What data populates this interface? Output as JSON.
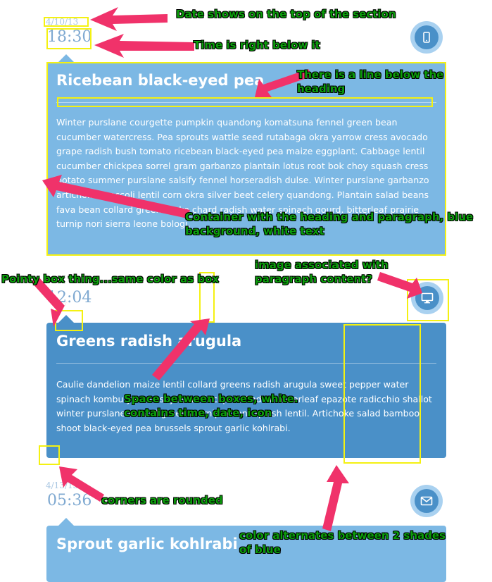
{
  "entries": [
    {
      "date": "4/10/13",
      "time": "18:30",
      "title": "Ricebean black-eyed pea",
      "body": "Winter purslane courgette pumpkin quandong komatsuna fennel green bean cucumber watercress. Pea sprouts wattle seed rutabaga okra yarrow cress avocado grape radish bush tomato ricebean black-eyed pea maize eggplant. Cabbage lentil cucumber chickpea sorrel gram garbanzo plantain lotus root bok choy squash cress potato summer purslane salsify fennel horseradish dulse. Winter purslane garbanzo artichoke broccoli lentil corn okra silver beet celery quandong. Plantain salad beans fava bean collard greens soko chard radish water spinach gourd. bitterleaf prairie turnip nori sierra leone bologi.",
      "icon": "phone-icon"
    },
    {
      "date": "",
      "time": "12:04",
      "title": "Greens radish arugula",
      "body": "Caulie dandelion maize lentil collard greens radish arugula sweet pepper water spinach kombu yarrow soybean chickpea. Endive bitterleaf epazote radicchio shallot winter purslane collard greens turnip onion squash lentil. Artichoke salad bamboo shoot black-eyed pea brussels sprout garlic kohlrabi.",
      "icon": "monitor-icon"
    },
    {
      "date": "4/13/13",
      "time": "05:36",
      "title": "Sprout garlic kohlrabi",
      "body": "",
      "icon": "mail-icon"
    }
  ],
  "colors": {
    "card_light": "#7cb8e4",
    "card_dark": "#4a90c8",
    "annotation_box": "#f4f112",
    "annotation_text": "#0b9e0b",
    "arrow": "#f0326a"
  },
  "annotations": {
    "date": "Date shows on the top of the section",
    "time": "Time is right below it",
    "line": "There is a line below the heading",
    "container": "Container with the heading and paragraph, blue background, white text",
    "image": "image associated with paragraph content?",
    "pointy": "Pointy box thing...same color as box",
    "space": "Space between boxes, white. contains time, date, icon",
    "corners": "corners are rounded",
    "color": "color alternates between 2 shades of blue"
  }
}
